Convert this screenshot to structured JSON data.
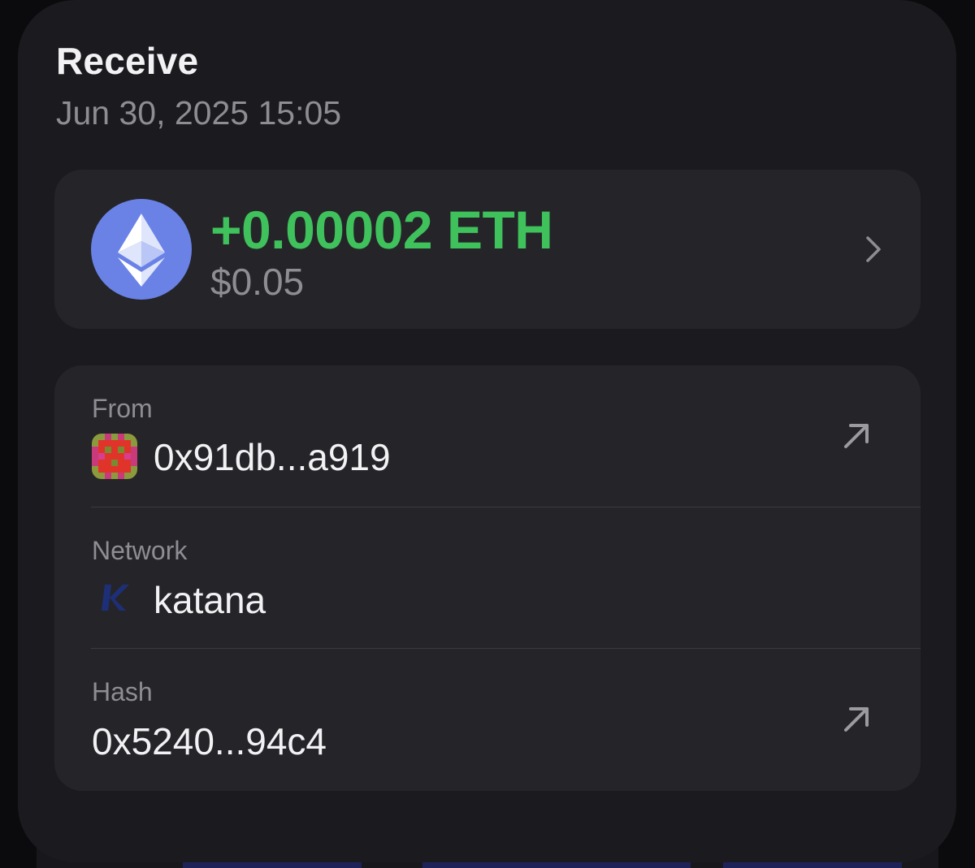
{
  "header": {
    "title": "Receive",
    "datetime": "Jun 30, 2025 15:05"
  },
  "amount_card": {
    "token_icon": "ethereum-icon",
    "amount": "+0.00002 ETH",
    "fiat_value": "$0.05",
    "accent_color": "#3fc15c"
  },
  "details": {
    "from": {
      "label": "From",
      "value": "0x91db...a919",
      "icon": "address-avatar-icon"
    },
    "network": {
      "label": "Network",
      "value": "katana",
      "icon": "katana-network-icon"
    },
    "hash": {
      "label": "Hash",
      "value": "0x5240...94c4"
    }
  }
}
